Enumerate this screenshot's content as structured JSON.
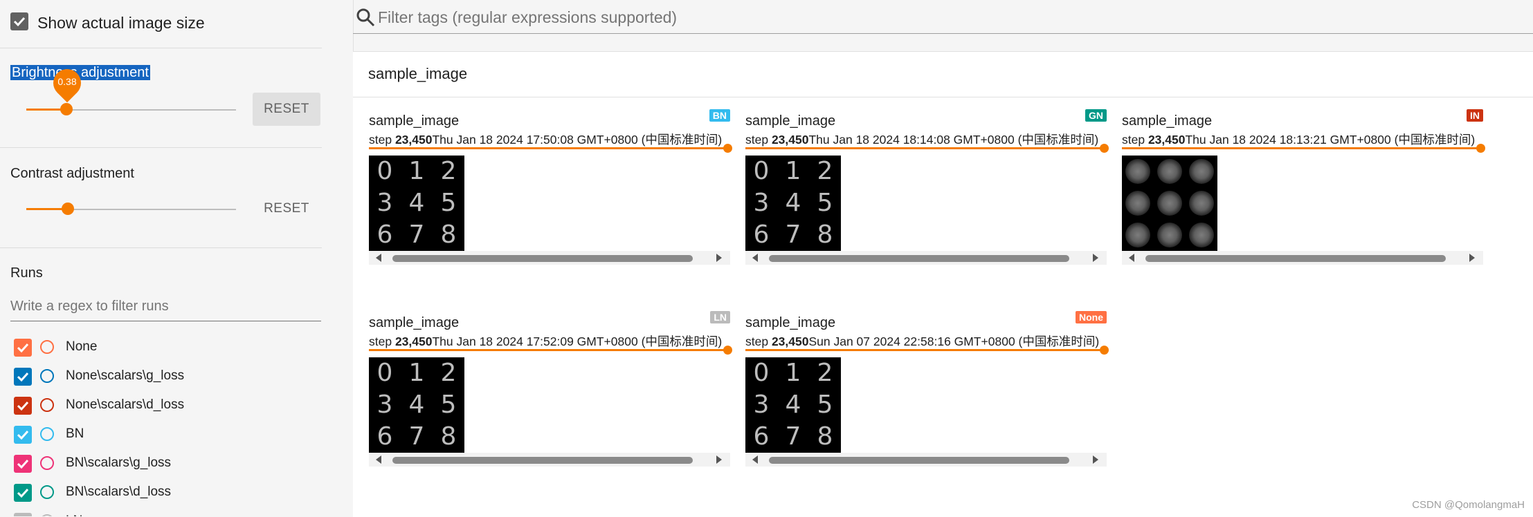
{
  "sidebar": {
    "show_actual_size": {
      "label": "Show actual image size",
      "checked": true
    },
    "brightness": {
      "label": "Brightness adjustment",
      "value_label": "0.38",
      "value": 0.38,
      "reset_label": "RESET"
    },
    "contrast": {
      "label": "Contrast adjustment",
      "reset_label": "RESET"
    },
    "runs": {
      "title": "Runs",
      "filter_placeholder": "Write a regex to filter runs",
      "items": [
        {
          "label": "None",
          "color": "#ff7043",
          "checked": true
        },
        {
          "label": "None\\scalars\\g_loss",
          "color": "#0077bb",
          "checked": true
        },
        {
          "label": "None\\scalars\\d_loss",
          "color": "#cc3311",
          "checked": true
        },
        {
          "label": "BN",
          "color": "#33bbee",
          "checked": true
        },
        {
          "label": "BN\\scalars\\g_loss",
          "color": "#ee3377",
          "checked": true
        },
        {
          "label": "BN\\scalars\\d_loss",
          "color": "#009988",
          "checked": true
        },
        {
          "label": "LN",
          "color": "#bbbbbb",
          "checked": true
        }
      ]
    }
  },
  "filter": {
    "placeholder": "Filter tags (regular expressions supported)"
  },
  "panel": {
    "title": "sample_image",
    "cards": [
      {
        "title": "sample_image",
        "badge": "BN",
        "badge_color": "#33bbee",
        "step_label": "step",
        "step": "23,450",
        "time": "Thu Jan 18 2024 17:50:08 GMT+0800 (中国标准时间)",
        "image": "digits"
      },
      {
        "title": "sample_image",
        "badge": "GN",
        "badge_color": "#009988",
        "step_label": "step",
        "step": "23,450",
        "time": "Thu Jan 18 2024 18:14:08 GMT+0800 (中国标准时间)",
        "image": "digits"
      },
      {
        "title": "sample_image",
        "badge": "IN",
        "badge_color": "#cc3311",
        "step_label": "step",
        "step": "23,450",
        "time": "Thu Jan 18 2024 18:13:21 GMT+0800 (中国标准时间)",
        "image": "noise"
      },
      {
        "title": "sample_image",
        "badge": "LN",
        "badge_color": "#bbbbbb",
        "step_label": "step",
        "step": "23,450",
        "time": "Thu Jan 18 2024 17:52:09 GMT+0800 (中国标准时间)",
        "image": "digits"
      },
      {
        "title": "sample_image",
        "badge": "None",
        "badge_color": "#ff7043",
        "step_label": "step",
        "step": "23,450",
        "time": "Sun Jan 07 2024 22:58:16 GMT+0800 (中国标准时间)",
        "image": "digits"
      }
    ],
    "digits": [
      "0",
      "1",
      "2",
      "3",
      "4",
      "5",
      "6",
      "7",
      "8"
    ]
  },
  "watermark": "CSDN @QomolangmaH"
}
